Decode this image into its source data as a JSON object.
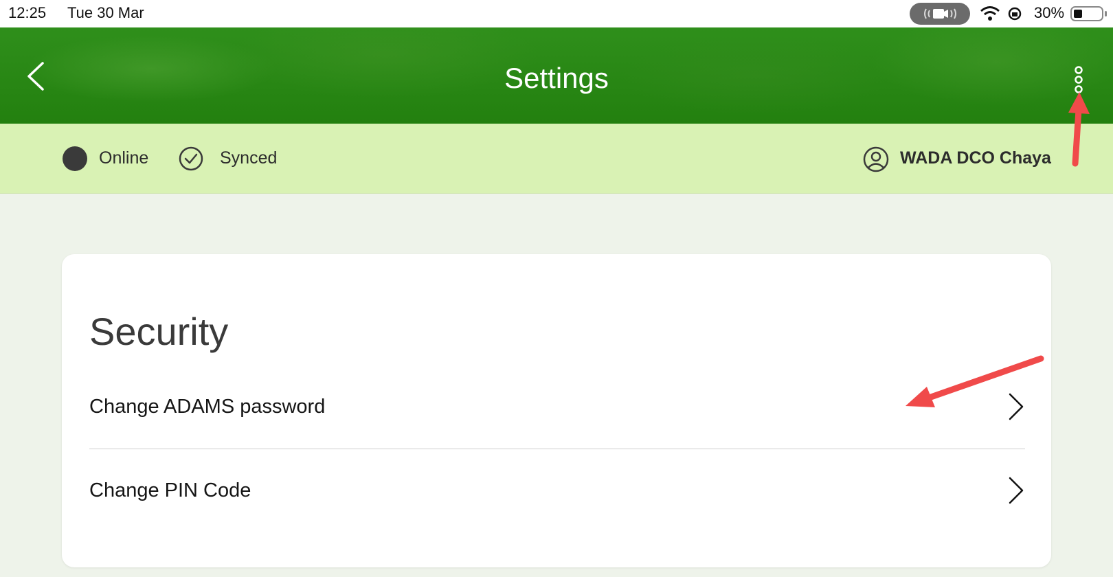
{
  "status_bar": {
    "time": "12:25",
    "date": "Tue 30 Mar",
    "battery": "30%"
  },
  "header": {
    "title": "Settings",
    "back_icon": "chevron-left-icon",
    "menu_icon": "more-vertical-icon"
  },
  "status_strip": {
    "online_label": "Online",
    "synced_label": "Synced",
    "user_name": "WADA DCO Chaya"
  },
  "security": {
    "title": "Security",
    "items": [
      {
        "label": "Change ADAMS password"
      },
      {
        "label": "Change PIN Code"
      }
    ]
  },
  "colors": {
    "header_green": "#23800f",
    "strip_green": "#d9f2b4",
    "page_bg": "#eef3ea",
    "annotation_red": "#f04a4a"
  }
}
